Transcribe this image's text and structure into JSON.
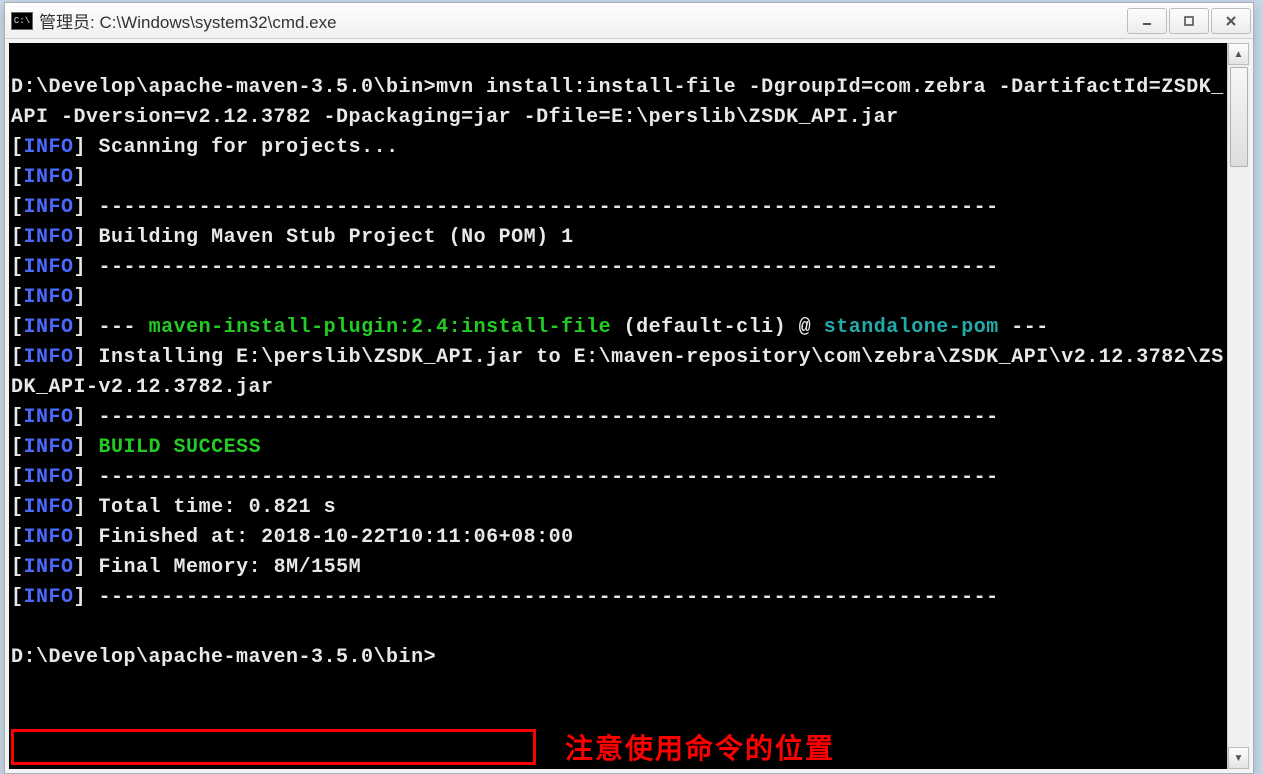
{
  "window": {
    "icon_label": "C:\\",
    "title": "管理员: C:\\Windows\\system32\\cmd.exe"
  },
  "term": {
    "cmd_prompt": "D:\\Develop\\apache-maven-3.5.0\\bin>",
    "cmd_line": "mvn install:install-file -DgroupId=com.zebra -DartifactId=ZSDK_API -Dversion=v2.12.3782 -Dpackaging=jar -Dfile=E:\\perslib\\ZSDK_API.jar",
    "info_label": "INFO",
    "scan": "Scanning for projects...",
    "sep": "------------------------------------------------------------------------",
    "build_line": "Building Maven Stub Project (No POM) 1",
    "plugin_pre": "--- ",
    "plugin_green": "maven-install-plugin:2.4:install-file",
    "plugin_mid": " (default-cli) @ ",
    "plugin_teal": "standalone-pom",
    "plugin_post": " ---",
    "install": "Installing E:\\perslib\\ZSDK_API.jar to E:\\maven-repository\\com\\zebra\\ZSDK_API\\v2.12.3782\\ZSDK_API-v2.12.3782.jar",
    "build_success": "BUILD SUCCESS",
    "total_time": "Total time: 0.821 s",
    "finished": "Finished at: 2018-10-22T10:11:06+08:00",
    "memory": "Final Memory: 8M/155M",
    "final_prompt": "D:\\Develop\\apache-maven-3.5.0\\bin>"
  },
  "annotation": {
    "text": "注意使用命令的位置"
  }
}
